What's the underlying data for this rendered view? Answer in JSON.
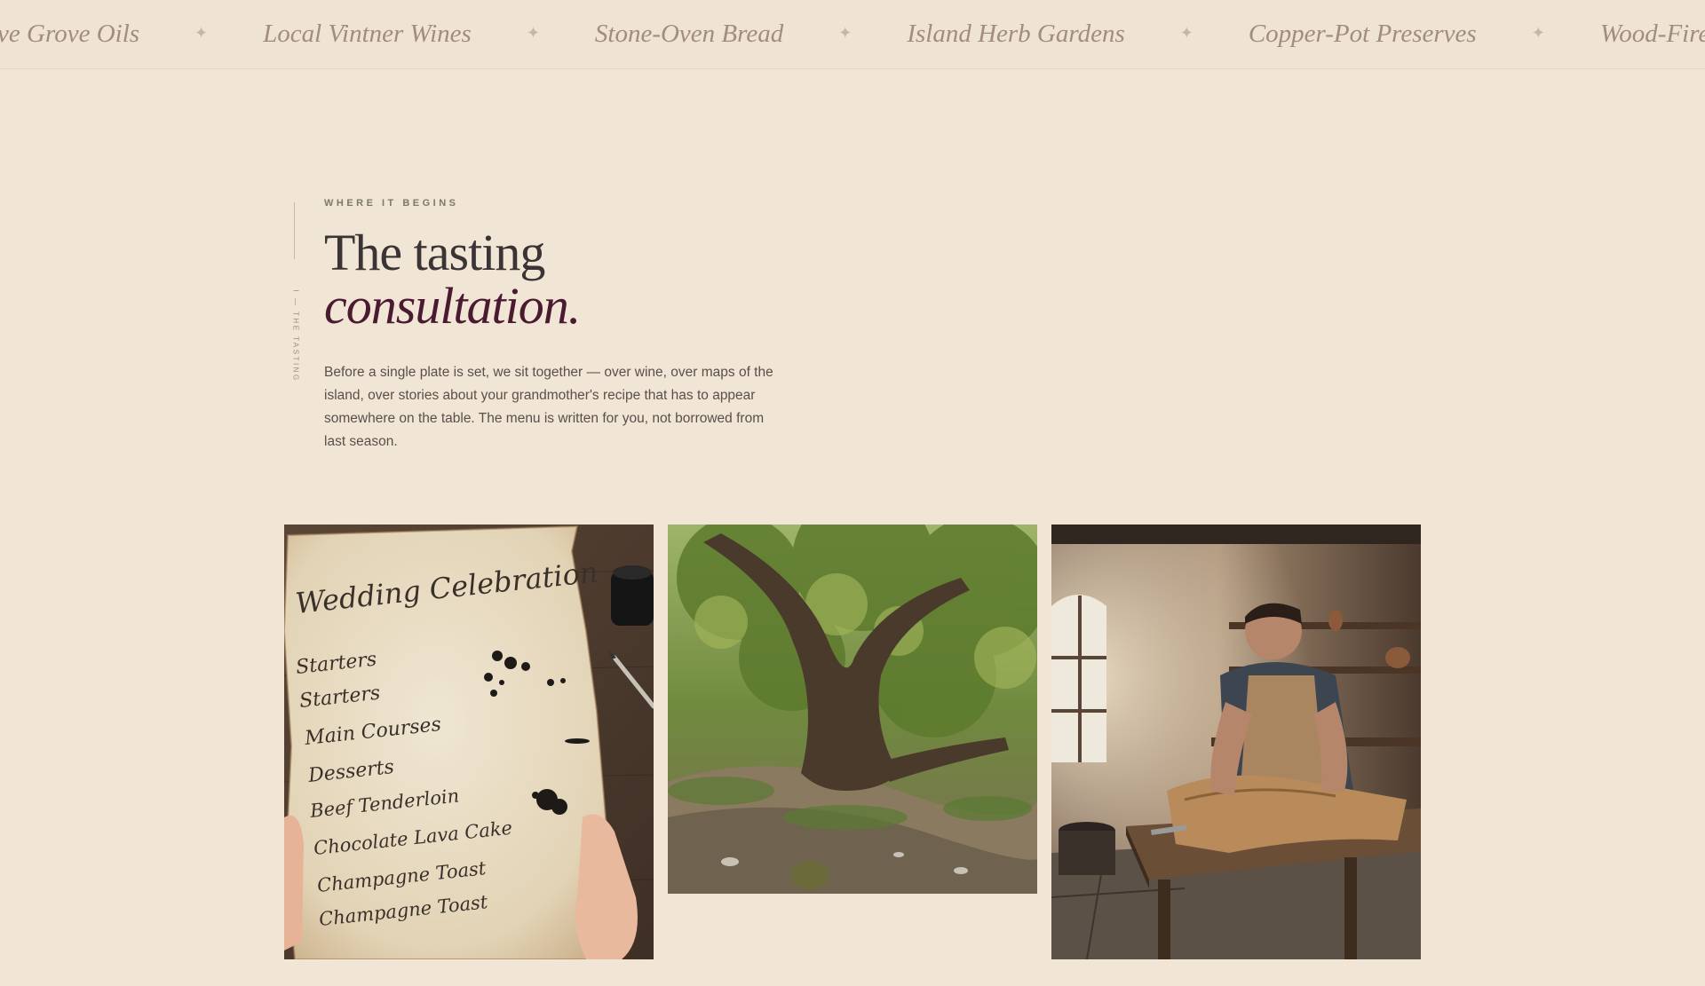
{
  "ticker": {
    "items": [
      "Olive Grove Oils",
      "Local Vintner Wines",
      "Stone-Oven Bread",
      "Island Herb Gardens",
      "Copper-Pot Preserves",
      "Wood-Fired"
    ],
    "separator": "✦"
  },
  "section": {
    "side_label": "I — THE TASTING",
    "eyebrow": "WHERE IT BEGINS",
    "headline_line1": "The tasting",
    "headline_line2": "consultation.",
    "body": "Before a single plate is set, we sit together — over wine, over maps of the island, over stories about your grandmother's recipe that has to appear somewhere on the table. The menu is written for you, not borrowed from last season."
  },
  "gallery": {
    "menu_card": {
      "title": "Wedding Celebration",
      "lines": [
        "Starters",
        "Starters",
        "Main Courses",
        "Desserts",
        "Beef Tenderloin",
        "Chocolate Lava Cake",
        "Champagne Toast",
        "Champagne Toast"
      ]
    }
  },
  "colors": {
    "background": "#f1e5d5",
    "accent_wine": "#4a1a30",
    "eyebrow_olive": "#7c7a63",
    "ticker_text": "#a08c80"
  }
}
